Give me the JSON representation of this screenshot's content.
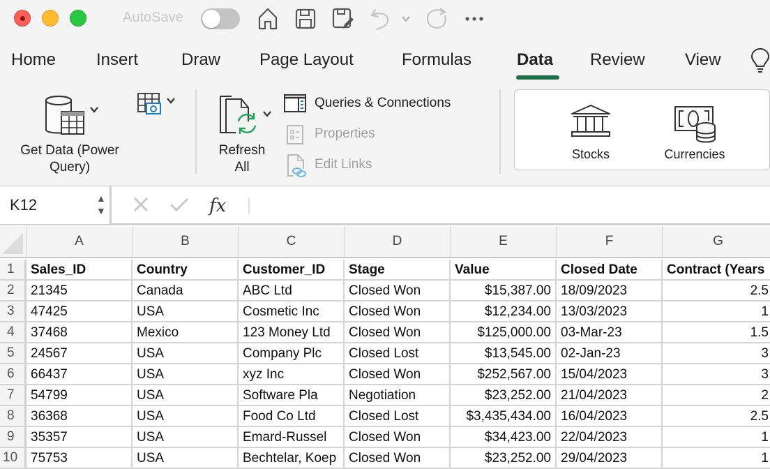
{
  "titlebar": {
    "autosave_label": "AutoSave",
    "autosave_on": false,
    "icons": [
      "home-icon",
      "save-icon",
      "save-as-icon",
      "undo-icon",
      "undo-dropdown-icon",
      "redo-icon",
      "more-icon"
    ]
  },
  "tabs": [
    {
      "label": "Home",
      "active": false
    },
    {
      "label": "Insert",
      "active": false
    },
    {
      "label": "Draw",
      "active": false
    },
    {
      "label": "Page Layout",
      "active": false
    },
    {
      "label": "Formulas",
      "active": false
    },
    {
      "label": "Data",
      "active": true
    },
    {
      "label": "Review",
      "active": false
    },
    {
      "label": "View",
      "active": false
    }
  ],
  "accent_color": "#1e6e46",
  "ribbon": {
    "get_data_line1": "Get Data (Power",
    "get_data_line2": "Query)",
    "refresh_line1": "Refresh",
    "refresh_line2": "All",
    "queries_connections": "Queries & Connections",
    "properties": "Properties",
    "edit_links": "Edit Links",
    "stocks": "Stocks",
    "currencies": "Currencies"
  },
  "formula_bar": {
    "name_box": "K12",
    "formula": ""
  },
  "sheet": {
    "columns": [
      "A",
      "B",
      "C",
      "D",
      "E",
      "F",
      "G"
    ],
    "rows": [
      {
        "n": "1",
        "cells": [
          "Sales_ID",
          "Country",
          "Customer_ID",
          "Stage",
          "Value",
          "Closed Date",
          "Contract (Years"
        ]
      },
      {
        "n": "2",
        "cells": [
          "21345",
          "Canada",
          "ABC Ltd",
          "Closed Won",
          "$15,387.00",
          "18/09/2023",
          "2.5"
        ]
      },
      {
        "n": "3",
        "cells": [
          "47425",
          "USA",
          "Cosmetic Inc",
          "Closed Won",
          "$12,234.00",
          "13/03/2023",
          "1"
        ]
      },
      {
        "n": "4",
        "cells": [
          "37468",
          "Mexico",
          "123 Money Ltd",
          "Closed Won",
          "$125,000.00",
          "03-Mar-23",
          "1.5"
        ]
      },
      {
        "n": "5",
        "cells": [
          "24567",
          "USA",
          "Company Plc",
          "Closed Lost",
          "$13,545.00",
          "02-Jan-23",
          "3"
        ]
      },
      {
        "n": "6",
        "cells": [
          "66437",
          "USA",
          "xyz Inc",
          "Closed Won",
          "$252,567.00",
          "15/04/2023",
          "3"
        ]
      },
      {
        "n": "7",
        "cells": [
          "54799",
          "USA",
          "Software Pla",
          "Negotiation",
          "$23,252.00",
          "21/04/2023",
          "2"
        ]
      },
      {
        "n": "8",
        "cells": [
          "36368",
          "USA",
          "Food Co Ltd",
          "Closed Lost",
          "$3,435,434.00",
          "16/04/2023",
          "2.5"
        ]
      },
      {
        "n": "9",
        "cells": [
          "35357",
          "USA",
          "Emard-Russel",
          "Closed Won",
          "$34,423.00",
          "22/04/2023",
          "1"
        ]
      },
      {
        "n": "10",
        "cells": [
          "75753",
          "USA",
          "Bechtelar, Koep",
          "Closed Won",
          "$23,252.00",
          "29/04/2023",
          "1"
        ]
      }
    ]
  }
}
